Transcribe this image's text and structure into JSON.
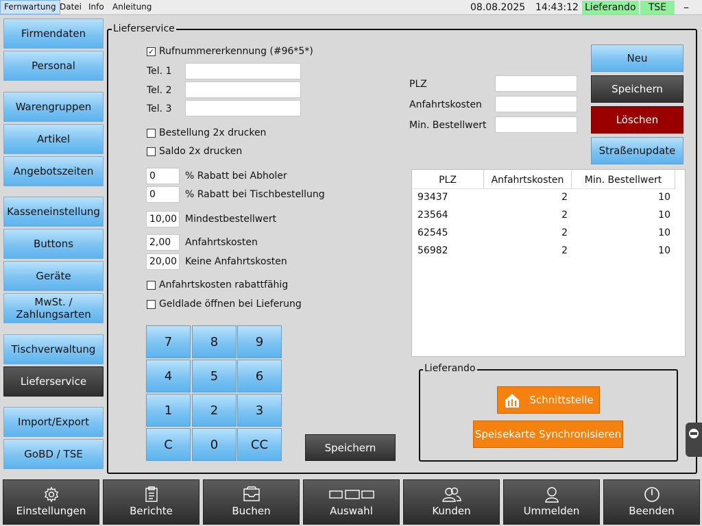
{
  "menubar": {
    "items": [
      "Fernwartung",
      "Datei",
      "Info",
      "Anleitung"
    ],
    "date": "08.08.2025",
    "time": "14:43:12",
    "lieferando_badge": "Lieferando",
    "tse_badge": "TSE",
    "minimize": "–"
  },
  "sidebar": {
    "items": [
      "Firmendaten",
      "Personal",
      "Warengruppen",
      "Artikel",
      "Angebotszeiten",
      "Kasseneinstellung",
      "Buttons",
      "Geräte",
      "MwSt. / Zahlungsarten",
      "Tischverwaltung",
      "Lieferservice",
      "Import/Export",
      "GoBD / TSE"
    ],
    "active": "Lieferservice"
  },
  "lieferservice": {
    "title": "Lieferservice",
    "rufnummer_label": "Rufnummerer­kennung (#96*5*)",
    "rufnummer_checked": true,
    "tel1_label": "Tel. 1",
    "tel2_label": "Tel. 2",
    "tel3_label": "Tel. 3",
    "tel1_value": "",
    "tel2_value": "",
    "tel3_value": "",
    "bestellung_2x_label": "Bestellung 2x drucken",
    "saldo_2x_label": "Saldo 2x drucken",
    "rabatt_abholer_value": "0",
    "rabatt_abholer_label": "% Rabatt bei Abholer",
    "rabatt_tisch_value": "0",
    "rabatt_tisch_label": "% Rabatt bei Tischbestellung",
    "mindestbestellwert_value": "10,00",
    "mindestbestellwert_label": "Mindestbestellwert",
    "anfahrtskosten_value": "2,00",
    "anfahrtskosten_label": "Anfahrtskosten",
    "keine_anfahrtskosten_value": "20,00",
    "keine_anfahrtskosten_label": "Keine Anfahrtskosten",
    "anfahrtskosten_rabatt_label": "Anfahrtskosten rabattfähig",
    "geldlade_label": "Geldlade öffnen bei Lieferung",
    "keypad": [
      "7",
      "8",
      "9",
      "4",
      "5",
      "6",
      "1",
      "2",
      "3",
      "C",
      "0",
      "CC"
    ],
    "save_label": "Speichern"
  },
  "plz_form": {
    "plz_label": "PLZ",
    "anfahrtskosten_label": "Anfahrtskosten",
    "min_bestellwert_label": "Min. Bestellwert",
    "plz_value": "",
    "anfahrtskosten_value": "",
    "min_bestellwert_value": ""
  },
  "actions": {
    "neu": "Neu",
    "speichern": "Speichern",
    "loeschen": "Löschen",
    "strassenupdate": "Straßenupdate"
  },
  "table": {
    "headers": [
      "PLZ",
      "Anfahrtskosten",
      "Min. Bestellwert"
    ],
    "rows": [
      [
        "93437",
        "2",
        "10"
      ],
      [
        "23564",
        "2",
        "10"
      ],
      [
        "62545",
        "2",
        "10"
      ],
      [
        "56982",
        "2",
        "10"
      ]
    ]
  },
  "lieferando": {
    "title": "Lieferando",
    "schnittstelle": "Schnittstelle",
    "sync": "Speisekarte Synchronisieren",
    "accent": "#f5820e"
  },
  "bottombar": {
    "items": [
      {
        "label": "Einstellungen",
        "icon": "gear-icon"
      },
      {
        "label": "Berichte",
        "icon": "clipboard-icon"
      },
      {
        "label": "Buchen",
        "icon": "inbox-icon"
      },
      {
        "label": "Auswahl",
        "icon": "boxes-icon"
      },
      {
        "label": "Kunden",
        "icon": "users-icon"
      },
      {
        "label": "Ummelden",
        "icon": "user-icon"
      },
      {
        "label": "Beenden",
        "icon": "power-icon"
      }
    ]
  }
}
